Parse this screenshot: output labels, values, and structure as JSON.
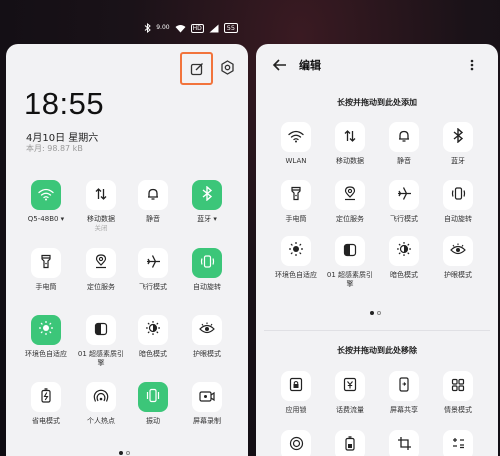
{
  "statusbar": {
    "data_speed": "9.00",
    "battery": "55",
    "hd_label": "HD"
  },
  "left": {
    "time": "18:55",
    "date": "4月10日 星期六",
    "monthly": "本月: 98.87 kB",
    "tiles": [
      {
        "label": "Q5-48B0",
        "icon": "wifi-icon",
        "on": true,
        "dropdown": true
      },
      {
        "label": "移动数据",
        "sub": "关闭",
        "icon": "mobile-data-icon",
        "on": false
      },
      {
        "label": "静音",
        "icon": "bell-icon",
        "on": false
      },
      {
        "label": "蓝牙",
        "icon": "bluetooth-icon",
        "on": true,
        "dropdown": true
      },
      {
        "label": "手电筒",
        "icon": "flashlight-icon",
        "on": false
      },
      {
        "label": "定位服务",
        "icon": "location-icon",
        "on": false
      },
      {
        "label": "飞行模式",
        "icon": "airplane-icon",
        "on": false
      },
      {
        "label": "自动旋转",
        "icon": "rotate-icon",
        "on": true
      },
      {
        "label": "环境色自适应",
        "icon": "adaptive-color-icon",
        "on": true
      },
      {
        "label": "01 超感素质引",
        "label2": "擎",
        "icon": "engine-icon",
        "on": false
      },
      {
        "label": "暗色模式",
        "icon": "dark-mode-icon",
        "on": false
      },
      {
        "label": "护眼模式",
        "icon": "eye-icon",
        "on": false
      },
      {
        "label": "省电模式",
        "icon": "battery-saver-icon",
        "on": false
      },
      {
        "label": "个人热点",
        "icon": "hotspot-icon",
        "on": false
      },
      {
        "label": "振动",
        "icon": "vibrate-icon",
        "on": true
      },
      {
        "label": "屏幕录制",
        "icon": "screen-record-icon",
        "on": false
      }
    ]
  },
  "right": {
    "title": "编辑",
    "add_section": "长按并拖动到此处添加",
    "remove_section": "长按并拖动到此处移除",
    "active_tiles": [
      {
        "label": "WLAN",
        "icon": "wifi-icon"
      },
      {
        "label": "移动数据",
        "icon": "mobile-data-icon"
      },
      {
        "label": "静音",
        "icon": "bell-icon"
      },
      {
        "label": "蓝牙",
        "icon": "bluetooth-icon"
      },
      {
        "label": "手电筒",
        "icon": "flashlight-icon"
      },
      {
        "label": "定位服务",
        "icon": "location-icon"
      },
      {
        "label": "飞行模式",
        "icon": "airplane-icon"
      },
      {
        "label": "自动旋转",
        "icon": "rotate-icon"
      },
      {
        "label": "环境色自适应",
        "icon": "adaptive-color-icon"
      },
      {
        "label": "01 超感素质引",
        "label2": "擎",
        "icon": "engine-icon"
      },
      {
        "label": "暗色模式",
        "icon": "dark-mode-icon"
      },
      {
        "label": "护眼模式",
        "icon": "eye-icon"
      }
    ],
    "spare_tiles": [
      {
        "label": "应用锁",
        "icon": "app-lock-icon"
      },
      {
        "label": "话费流量",
        "icon": "billing-icon"
      },
      {
        "label": "屏幕共享",
        "icon": "screen-share-icon"
      },
      {
        "label": "情景模式",
        "icon": "scene-mode-icon"
      },
      {
        "label": "",
        "icon": "target-icon"
      },
      {
        "label": "",
        "icon": "battery-icon"
      },
      {
        "label": "",
        "icon": "crop-icon"
      },
      {
        "label": "",
        "icon": "calculator-icon"
      }
    ]
  },
  "colors": {
    "accent": "#3cc679",
    "highlight": "#f2743c",
    "panel": "#f2f2f4"
  }
}
